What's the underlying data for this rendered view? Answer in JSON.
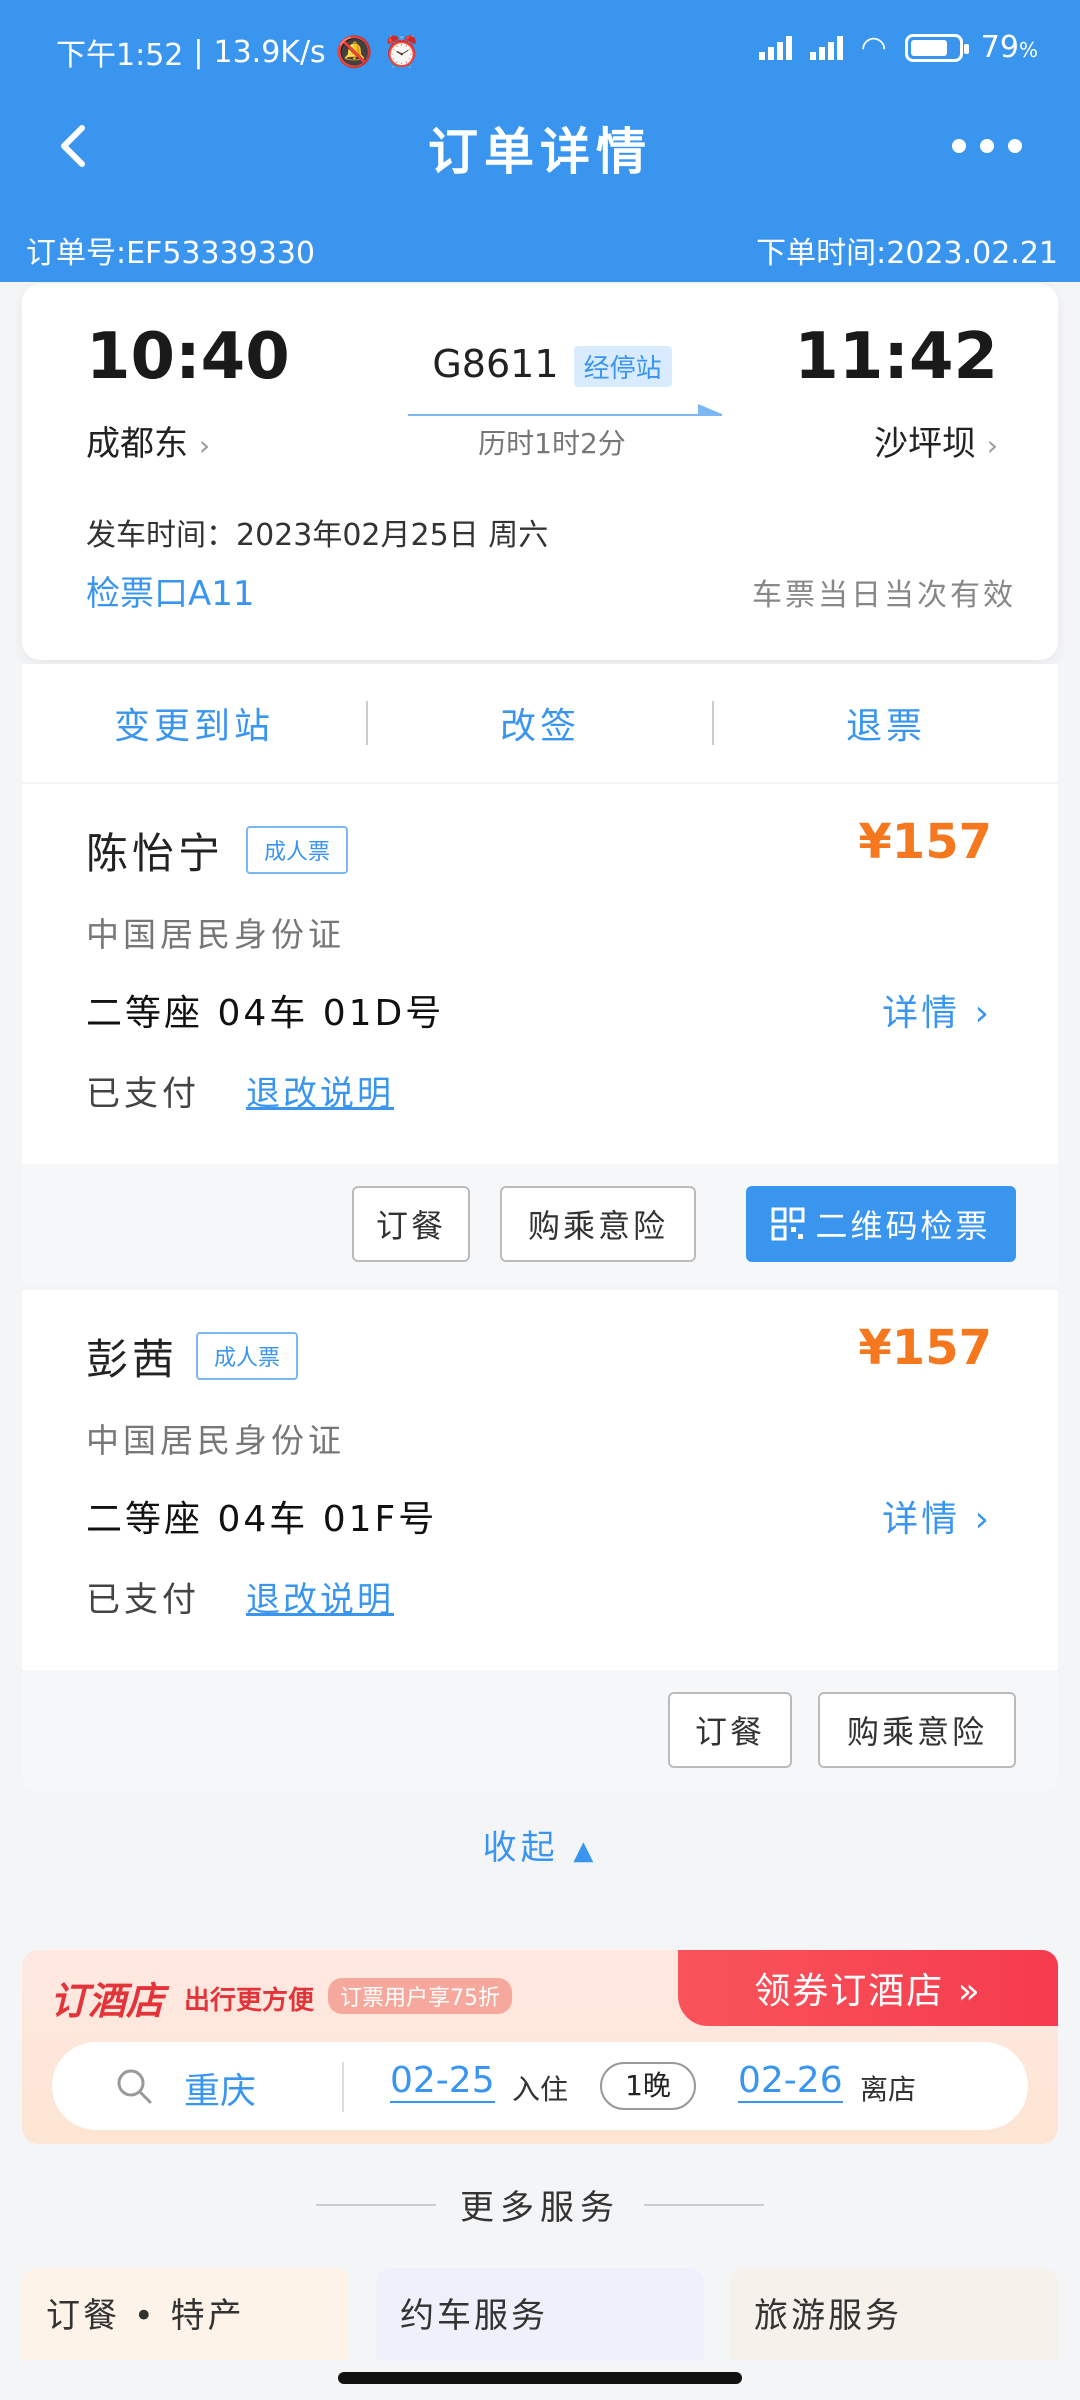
{
  "status_bar": {
    "time": "下午1:52",
    "net_speed": "13.9K/s",
    "battery": "79",
    "battery_unit": "%",
    "battery_level": 0.79
  },
  "nav": {
    "title": "订单详情"
  },
  "order": {
    "number": "订单号:EF53339330",
    "placed_time": "下单时间:2023.02.21"
  },
  "trip": {
    "depart_time": "10:40",
    "depart_station": "成都东",
    "arrive_time": "11:42",
    "arrive_station": "沙坪坝",
    "train_no": "G8611",
    "via_label": "经停站",
    "duration": "历时1时2分",
    "depart_date": "发车时间：2023年02月25日 周六",
    "gate": "检票口A11",
    "validity": "车票当日当次有效"
  },
  "actions": {
    "change_station": "变更到站",
    "rebook": "改签",
    "refund": "退票"
  },
  "passengers": [
    {
      "name": "陈怡宁",
      "ticket_type": "成人票",
      "price": "¥157",
      "id_type": "中国居民身份证",
      "seat": "二等座 04车 01D号",
      "detail": "详情 ›",
      "pay_status": "已支付",
      "refund_rules": "退改说明"
    },
    {
      "name": "彭茜",
      "ticket_type": "成人票",
      "price": "¥157",
      "id_type": "中国居民身份证",
      "seat": "二等座 04车 01F号",
      "detail": "详情 ›",
      "pay_status": "已支付",
      "refund_rules": "退改说明"
    }
  ],
  "buttons": {
    "meal": "订餐",
    "insurance": "购乘意险",
    "qr_check": "二维码检票"
  },
  "collapse": "收起",
  "hotel": {
    "brand": "订酒店",
    "slogan": "出行更方便",
    "promo": "订票用户享75折",
    "cta": "领券订酒店 »",
    "city": "重庆",
    "checkin_date": "02-25",
    "checkin_label": "入住",
    "nights": "1晚",
    "checkout_date": "02-26",
    "checkout_label": "离店"
  },
  "more_services": {
    "title": "更多服务",
    "items": [
      "订餐 • 特产",
      "约车服务",
      "旅游服务"
    ]
  },
  "colors": {
    "primary": "#3a95ef",
    "price": "#f5781f",
    "hotel_red": "#e3343a"
  }
}
